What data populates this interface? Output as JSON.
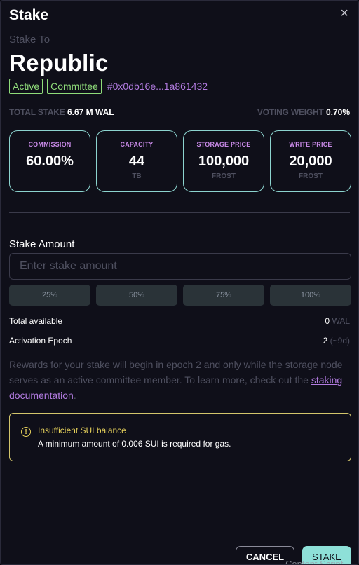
{
  "modal": {
    "title": "Stake",
    "close_glyph": "×",
    "stake_to_label": "Stake To",
    "node_name": "Republic",
    "tags": [
      "Active",
      "Committee"
    ],
    "address": "#0x0db16e...1a861432"
  },
  "stats": {
    "total_stake_label": "TOTAL STAKE",
    "total_stake_value": "6.67 M WAL",
    "voting_weight_label": "VOTING WEIGHT",
    "voting_weight_value": "0.70%"
  },
  "cards": [
    {
      "label": "COMMISSION",
      "value": "60.00%",
      "unit": ""
    },
    {
      "label": "CAPACITY",
      "value": "44",
      "unit": "TB"
    },
    {
      "label": "STORAGE PRICE",
      "value": "100,000",
      "unit": "FROST"
    },
    {
      "label": "WRITE PRICE",
      "value": "20,000",
      "unit": "FROST"
    }
  ],
  "stake_amount": {
    "label": "Stake Amount",
    "placeholder": "Enter stake amount",
    "value": "",
    "percent_buttons": [
      "25%",
      "50%",
      "75%",
      "100%"
    ]
  },
  "details": {
    "total_available_label": "Total available",
    "total_available_value": "0",
    "total_available_unit": "WAL",
    "activation_epoch_label": "Activation Epoch",
    "activation_epoch_value": "2",
    "activation_epoch_note": "(~9d)"
  },
  "info": {
    "text_before_link": "Rewards for your stake will begin in epoch 2 and only while the storage node serves as an active committee member. To learn more, check out the ",
    "link_text": "staking documentation",
    "text_after_link": "."
  },
  "warning": {
    "icon_glyph": "!",
    "title": "Insufficient SUI balance",
    "message": "A minimum amount of 0.006 SUI is required for gas."
  },
  "buttons": {
    "cancel": "CANCEL",
    "stake": "STAKE"
  },
  "overlay": {
    "text": "Content Script"
  },
  "colors": {
    "background": "#0f0f19",
    "tag_green": "#8fdc7a",
    "address_purple": "#b27be0",
    "card_border": "#8cd4cf",
    "warning_yellow": "#e5d05b",
    "stake_button": "#8ee0d8"
  }
}
